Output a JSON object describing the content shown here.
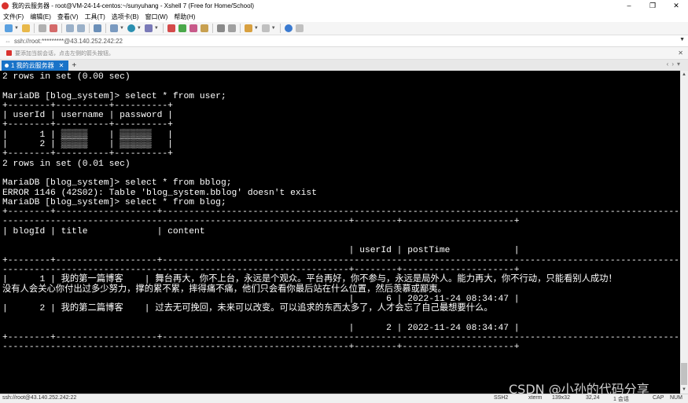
{
  "window": {
    "title": "我的云服务器 - root@VM-24-14-centos:~/sunyuhang - Xshell 7 (Free for Home/School)",
    "controls": [
      "–",
      "❐",
      "✕"
    ]
  },
  "menu": [
    "文件(F)",
    "编辑(E)",
    "查看(V)",
    "工具(T)",
    "选项卡(B)",
    "窗口(W)",
    "帮助(H)"
  ],
  "address": {
    "value": "ssh://root:*********@43.140.252.242:22"
  },
  "hint": {
    "text": "要添加当前会话，点击左侧的箭头按钮。"
  },
  "tab": {
    "label": "1 我的云服务器"
  },
  "terminal": {
    "lines": [
      "2 rows in set (0.00 sec)",
      "",
      "MariaDB [blog_system]> select * from user;",
      "+--------+----------+----------+",
      "| userId | username | password |",
      "+--------+----------+----------+",
      "|      1 | ▒▒▒▒▒    | ▒▒▒▒▒▒   |",
      "|      2 | ▒▒▒▒▒    | ▒▒▒▒▒▒   |",
      "+--------+----------+----------+",
      "2 rows in set (0.01 sec)",
      "",
      "MariaDB [blog_system]> select * from bblog;",
      "ERROR 1146 (42S02): Table 'blog_system.bblog' doesn't exist",
      "MariaDB [blog_system]> select * from blog;",
      "+--------+-------------------+-----------------------------------------------------------------------------------------------------",
      "-----------------------------------------------------------------+--------+---------------------+",
      "| blogId | title             | content",
      "",
      "                                                                 | userId | postTime            |",
      "+--------+-------------------+-----------------------------------------------------------------------------------------------------",
      "-----------------------------------------------------------------+--------+---------------------+",
      "|      1 | 我的第一篇博客    | 舞台再大，你不上台，永远是个观众。平台再好，你不参与，永远是局外人。能力再大，你不行动，只能看别人成功！",
      "没有人会关心你付出过多少努力，撑的累不累，摔得痛不痛，他们只会看你最后站在什么位置，然后羡慕或鄙夷。",
      "                                                                 |      6 | 2022-11-24 08:34:47 |",
      "|      2 | 我的第二篇博客    | 过去无可挽回，未来可以改变。可以追求的东西太多了，人才会忘了自己最想要什么。",
      "",
      "                                                                 |      2 | 2022-11-24 08:34:47 |",
      "+--------+-------------------+-----------------------------------------------------------------------------------------------------",
      "-----------------------------------------------------------------+--------+---------------------+"
    ]
  },
  "status": {
    "connection": "ssh://root@43.140.252.242:22",
    "protocol": "SSH2",
    "terminal_type": "xterm",
    "size": "139x32",
    "cursor": "32,24",
    "sessions": "1 会话",
    "caps": "CAP",
    "num": "NUM"
  },
  "watermark": "CSDN @小孙的代码分享",
  "colors": {
    "tab_active": "#1a73c8",
    "terminal_bg": "#000000",
    "terminal_fg": "#ffffff",
    "app_icon": "#d9322e"
  },
  "icons": [
    "new-session-icon",
    "open-folder-icon",
    "reconnect-icon",
    "disconnect-icon",
    "copy-icon",
    "paste-icon",
    "find-icon",
    "properties-icon",
    "font-icon",
    "color-icon",
    "transfer-icon",
    "xftp-icon",
    "script-icon",
    "lock-icon",
    "keyboard-icon",
    "compose-icon",
    "layout-icon",
    "help-icon",
    "chat-icon"
  ]
}
